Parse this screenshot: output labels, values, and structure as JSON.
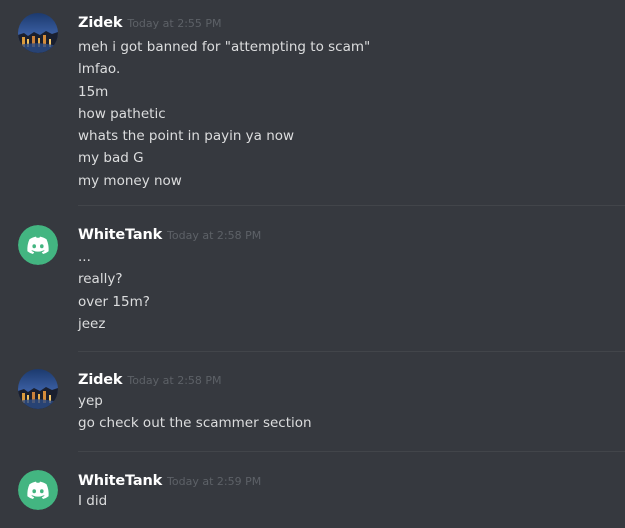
{
  "messages": [
    {
      "username": "Zidek",
      "timestamp": "Today at 2:55 PM",
      "avatar_icon": "city-night-avatar",
      "lines": [
        "meh i got banned for \"attempting to scam\"",
        "lmfao.",
        "15m",
        "how pathetic",
        "whats the point in payin ya now",
        "my bad G",
        "my money now"
      ]
    },
    {
      "username": "WhiteTank",
      "timestamp": "Today at 2:58 PM",
      "avatar_icon": "discord-logo-avatar",
      "lines": [
        "...",
        "really?",
        "over 15m?",
        "jeez"
      ]
    },
    {
      "username": "Zidek",
      "timestamp": "Today at 2:58 PM",
      "avatar_icon": "city-night-avatar",
      "lines": [
        "yep",
        "go check out the scammer section"
      ]
    },
    {
      "username": "WhiteTank",
      "timestamp": "Today at 2:59 PM",
      "avatar_icon": "discord-logo-avatar",
      "lines": [
        "I did"
      ]
    }
  ],
  "colors": {
    "background": "#36393f",
    "username": "#ffffff",
    "timestamp": "#5d6167",
    "text": "#dcddde",
    "discord_green": "#43b581",
    "divider": "#42454a"
  }
}
